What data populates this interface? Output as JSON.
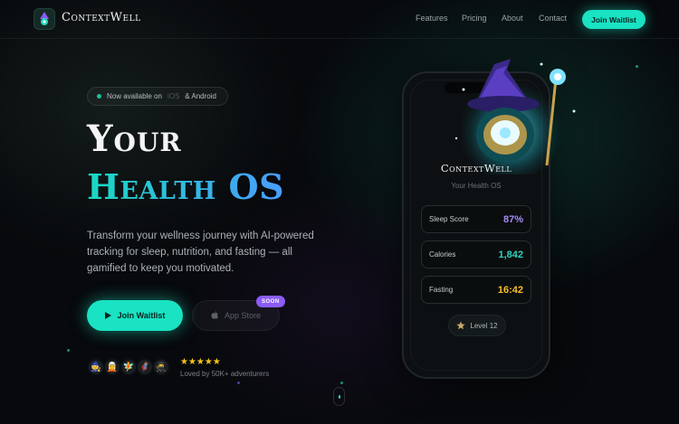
{
  "nav": {
    "brand": "ContextWell",
    "links": [
      "Features",
      "Pricing",
      "About",
      "Contact"
    ],
    "cta": "Join Waitlist"
  },
  "hero": {
    "badge": {
      "prefix": "Now available on",
      "muted": "iOS",
      "suffix": "& Android"
    },
    "title_line1": "Your",
    "title_line2": "Health OS",
    "description": "Transform your wellness journey with AI-powered tracking for sleep, nutrition, and fasting — all gamified to keep you motivated.",
    "primary_button": "Join Waitlist",
    "store_button": "App Store",
    "soon_badge": "SOON",
    "stars": "★★★★★",
    "social_proof": "Loved by 50K+ adventurers"
  },
  "phone": {
    "app_name": "ContextWell",
    "tagline": "Your Health OS",
    "stats": [
      {
        "label": "Sleep Score",
        "value": "87%",
        "color": "#a78bfa"
      },
      {
        "label": "Calories",
        "value": "1,842",
        "color": "#2dd4bf"
      },
      {
        "label": "Fasting",
        "value": "16:42",
        "color": "#fbbf24"
      }
    ],
    "level": "Level 12"
  },
  "colors": {
    "accent": "#19e3c3",
    "soon": "#8b5cf6",
    "star": "#f5c518"
  },
  "icons": [
    "wizard-logo-icon",
    "play-icon",
    "apple-icon",
    "star-icon",
    "wizard-mascot-icon"
  ]
}
